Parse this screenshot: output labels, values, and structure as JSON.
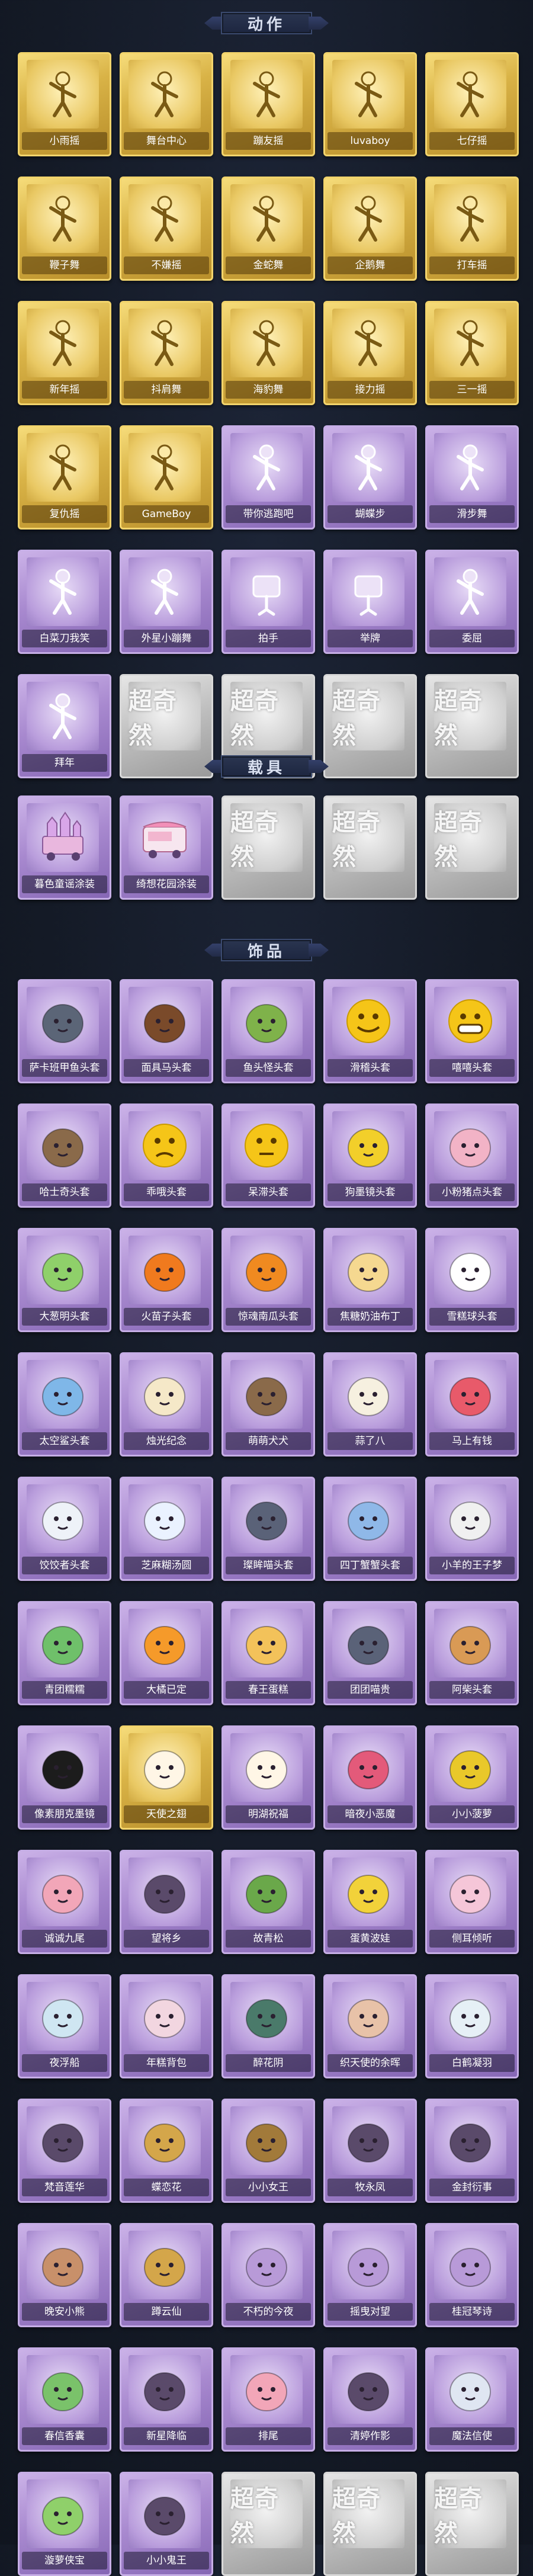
{
  "sections": [
    {
      "title": "动作",
      "items": [
        {
          "label": "小雨摇",
          "tier": "gold",
          "icon": "dance-pose-icon"
        },
        {
          "label": "舞台中心",
          "tier": "gold",
          "icon": "dance-pose-icon"
        },
        {
          "label": "蹦友摇",
          "tier": "gold",
          "icon": "dance-pose-icon"
        },
        {
          "label": "luvaboy",
          "tier": "gold",
          "icon": "dance-pose-icon"
        },
        {
          "label": "七仔摇",
          "tier": "gold",
          "icon": "dance-pose-icon"
        },
        {
          "label": "鞭子舞",
          "tier": "gold",
          "icon": "dance-pose-icon"
        },
        {
          "label": "不嫌摇",
          "tier": "gold",
          "icon": "dance-pose-icon"
        },
        {
          "label": "金蛇舞",
          "tier": "gold",
          "icon": "dance-pose-icon"
        },
        {
          "label": "企鹅舞",
          "tier": "gold",
          "icon": "dance-pose-icon"
        },
        {
          "label": "打车摇",
          "tier": "gold",
          "icon": "dance-pose-icon"
        },
        {
          "label": "新年摇",
          "tier": "gold",
          "icon": "dance-pose-icon"
        },
        {
          "label": "抖肩舞",
          "tier": "gold",
          "icon": "dance-pose-icon"
        },
        {
          "label": "海豹舞",
          "tier": "gold",
          "icon": "dance-pose-icon"
        },
        {
          "label": "接力摇",
          "tier": "gold",
          "icon": "dance-pose-icon"
        },
        {
          "label": "三一摇",
          "tier": "gold",
          "icon": "dance-pose-icon"
        },
        {
          "label": "复仇摇",
          "tier": "gold",
          "icon": "dance-pose-icon"
        },
        {
          "label": "GameBoy",
          "tier": "gold",
          "icon": "dance-pose-icon"
        },
        {
          "label": "带你逃跑吧",
          "tier": "purple",
          "icon": "dance-pose-icon"
        },
        {
          "label": "蝴蝶步",
          "tier": "purple",
          "icon": "dance-pose-icon"
        },
        {
          "label": "滑步舞",
          "tier": "purple",
          "icon": "dance-pose-icon"
        },
        {
          "label": "白菜刀我笑",
          "tier": "purple",
          "icon": "dance-pose-icon"
        },
        {
          "label": "外星小蹦舞",
          "tier": "purple",
          "icon": "dance-pose-icon"
        },
        {
          "label": "拍手",
          "tier": "purple",
          "icon": "cat-pose-icon"
        },
        {
          "label": "举牌",
          "tier": "purple",
          "icon": "sign-pose-icon"
        },
        {
          "label": "委屈",
          "tier": "purple",
          "icon": "dance-pose-icon"
        },
        {
          "label": "拜年",
          "tier": "purple",
          "icon": "dance-pose-icon"
        },
        {
          "label": "",
          "tier": "gray",
          "icon": "watermark"
        },
        {
          "label": "",
          "tier": "gray",
          "icon": "watermark"
        },
        {
          "label": "",
          "tier": "gray",
          "icon": "watermark"
        },
        {
          "label": "",
          "tier": "gray",
          "icon": "watermark"
        }
      ]
    },
    {
      "title": "载具",
      "items": [
        {
          "label": "暮色童谣涂装",
          "tier": "purple",
          "icon": "castle-vehicle-icon"
        },
        {
          "label": "绮想花园涂装",
          "tier": "purple",
          "icon": "food-truck-icon"
        },
        {
          "label": "",
          "tier": "gray",
          "icon": "watermark"
        },
        {
          "label": "",
          "tier": "gray",
          "icon": "watermark"
        },
        {
          "label": "",
          "tier": "gray",
          "icon": "watermark"
        }
      ]
    },
    {
      "title": "饰品",
      "items": [
        {
          "label": "萨卡班甲鱼头套",
          "tier": "purple",
          "icon": "fish-head-icon"
        },
        {
          "label": "面具马头套",
          "tier": "purple",
          "icon": "horse-head-icon"
        },
        {
          "label": "鱼头怪头套",
          "tier": "purple",
          "icon": "frog-head-icon"
        },
        {
          "label": "滑稽头套",
          "tier": "purple",
          "icon": "smile-emoji-icon"
        },
        {
          "label": "嘻嘻头套",
          "tier": "purple",
          "icon": "grin-emoji-icon"
        },
        {
          "label": "哈士奇头套",
          "tier": "purple",
          "icon": "dog-head-icon"
        },
        {
          "label": "乖哦头套",
          "tier": "purple",
          "icon": "sad-emoji-icon"
        },
        {
          "label": "呆滞头套",
          "tier": "purple",
          "icon": "dazed-emoji-icon"
        },
        {
          "label": "狗墨镜头套",
          "tier": "purple",
          "icon": "pikachu-sunglasses-icon"
        },
        {
          "label": "小粉猪点头套",
          "tier": "purple",
          "icon": "pink-blob-icon"
        },
        {
          "label": "大葱明头套",
          "tier": "purple",
          "icon": "bokchoy-icon"
        },
        {
          "label": "火苗子头套",
          "tier": "purple",
          "icon": "flame-icon"
        },
        {
          "label": "惊魂南瓜头套",
          "tier": "purple",
          "icon": "pumpkin-icon"
        },
        {
          "label": "焦糖奶油布丁",
          "tier": "purple",
          "icon": "pudding-icon"
        },
        {
          "label": "雪糕球头套",
          "tier": "purple",
          "icon": "snowman-icon"
        },
        {
          "label": "太空鲨头套",
          "tier": "purple",
          "icon": "shark-icon"
        },
        {
          "label": "烛光纪念",
          "tier": "purple",
          "icon": "candle-icon"
        },
        {
          "label": "萌萌犬犬",
          "tier": "purple",
          "icon": "dog-head-icon"
        },
        {
          "label": "蒜了八",
          "tier": "purple",
          "icon": "garlic-icon"
        },
        {
          "label": "马上有钱",
          "tier": "purple",
          "icon": "bird-icon"
        },
        {
          "label": "饺饺者头套",
          "tier": "purple",
          "icon": "dumpling-icon"
        },
        {
          "label": "芝麻糊汤圆",
          "tier": "purple",
          "icon": "ghost-icon"
        },
        {
          "label": "璨眸喵头套",
          "tier": "purple",
          "icon": "cat-head-icon"
        },
        {
          "label": "四丁蟹蟹头套",
          "tier": "purple",
          "icon": "crab-icon"
        },
        {
          "label": "小羊的王子梦",
          "tier": "purple",
          "icon": "sheep-icon"
        },
        {
          "label": "青团糯糯",
          "tier": "purple",
          "icon": "green-bun-icon"
        },
        {
          "label": "大橘已定",
          "tier": "purple",
          "icon": "orange-icon"
        },
        {
          "label": "春王蛋糕",
          "tier": "purple",
          "icon": "cake-icon"
        },
        {
          "label": "团团喵贵",
          "tier": "purple",
          "icon": "cat-head-icon"
        },
        {
          "label": "阿柴头套",
          "tier": "purple",
          "icon": "shiba-icon"
        },
        {
          "label": "像素朋克墨镜",
          "tier": "purple",
          "icon": "pixel-sunglasses-icon"
        },
        {
          "label": "天使之翅",
          "tier": "gold",
          "icon": "angel-icon"
        },
        {
          "label": "明湖祝福",
          "tier": "purple",
          "icon": "angel-icon"
        },
        {
          "label": "暗夜小恶魔",
          "tier": "purple",
          "icon": "devil-icon"
        },
        {
          "label": "小小菠萝",
          "tier": "purple",
          "icon": "pineapple-icon"
        },
        {
          "label": "诚诚九尾",
          "tier": "purple",
          "icon": "fox-icon"
        },
        {
          "label": "望将乡",
          "tier": "purple",
          "icon": "doll-icon"
        },
        {
          "label": "故青松",
          "tier": "purple",
          "icon": "bonsai-icon"
        },
        {
          "label": "蛋黄波娃",
          "tier": "purple",
          "icon": "yellow-blob-icon"
        },
        {
          "label": "侧耳倾听",
          "tier": "purple",
          "icon": "flower-icon"
        },
        {
          "label": "夜浮船",
          "tier": "purple",
          "icon": "lantern-icon"
        },
        {
          "label": "年糕背包",
          "tier": "purple",
          "icon": "backpack-icon"
        },
        {
          "label": "醉花阴",
          "tier": "purple",
          "icon": "pendant-icon"
        },
        {
          "label": "织天使的余晖",
          "tier": "purple",
          "icon": "girl-icon"
        },
        {
          "label": "白鹤凝羽",
          "tier": "purple",
          "icon": "bottle-icon"
        },
        {
          "label": "梵音莲华",
          "tier": "purple",
          "icon": "doll-icon"
        },
        {
          "label": "蝶恋花",
          "tier": "purple",
          "icon": "fairy-icon"
        },
        {
          "label": "小小女王",
          "tier": "purple",
          "icon": "queen-icon"
        },
        {
          "label": "牧永凤",
          "tier": "purple",
          "icon": "doll-icon"
        },
        {
          "label": "金封衍事",
          "tier": "purple",
          "icon": "doll-icon"
        },
        {
          "label": "晚安小熊",
          "tier": "purple",
          "icon": "bear-keychain-icon"
        },
        {
          "label": "蹲云仙",
          "tier": "purple",
          "icon": "fairy-icon"
        },
        {
          "label": "不朽的今夜",
          "tier": "purple",
          "icon": "keychain-icon"
        },
        {
          "label": "摇曳对望",
          "tier": "purple",
          "icon": "keychain-icon"
        },
        {
          "label": "桂冠琴诗",
          "tier": "purple",
          "icon": "keychain-icon"
        },
        {
          "label": "春信香囊",
          "tier": "purple",
          "icon": "sachet-icon"
        },
        {
          "label": "新星降临",
          "tier": "purple",
          "icon": "doll-icon"
        },
        {
          "label": "排尾",
          "tier": "purple",
          "icon": "fox-icon"
        },
        {
          "label": "清婷作影",
          "tier": "purple",
          "icon": "doll-icon"
        },
        {
          "label": "魔法信使",
          "tier": "purple",
          "icon": "mouse-icon"
        },
        {
          "label": "漩萝侠宝",
          "tier": "purple",
          "icon": "alien-icon"
        },
        {
          "label": "小小鬼王",
          "tier": "purple",
          "icon": "doll-icon"
        },
        {
          "label": "",
          "tier": "gray",
          "icon": "watermark"
        },
        {
          "label": "",
          "tier": "gray",
          "icon": "watermark"
        },
        {
          "label": "",
          "tier": "gray",
          "icon": "watermark"
        }
      ]
    }
  ],
  "watermark_text": "超奇然",
  "colors": {
    "background": "#151b28",
    "gold": "#e0bb50",
    "purple": "#a889cf",
    "gray": "#bdbdbd"
  }
}
